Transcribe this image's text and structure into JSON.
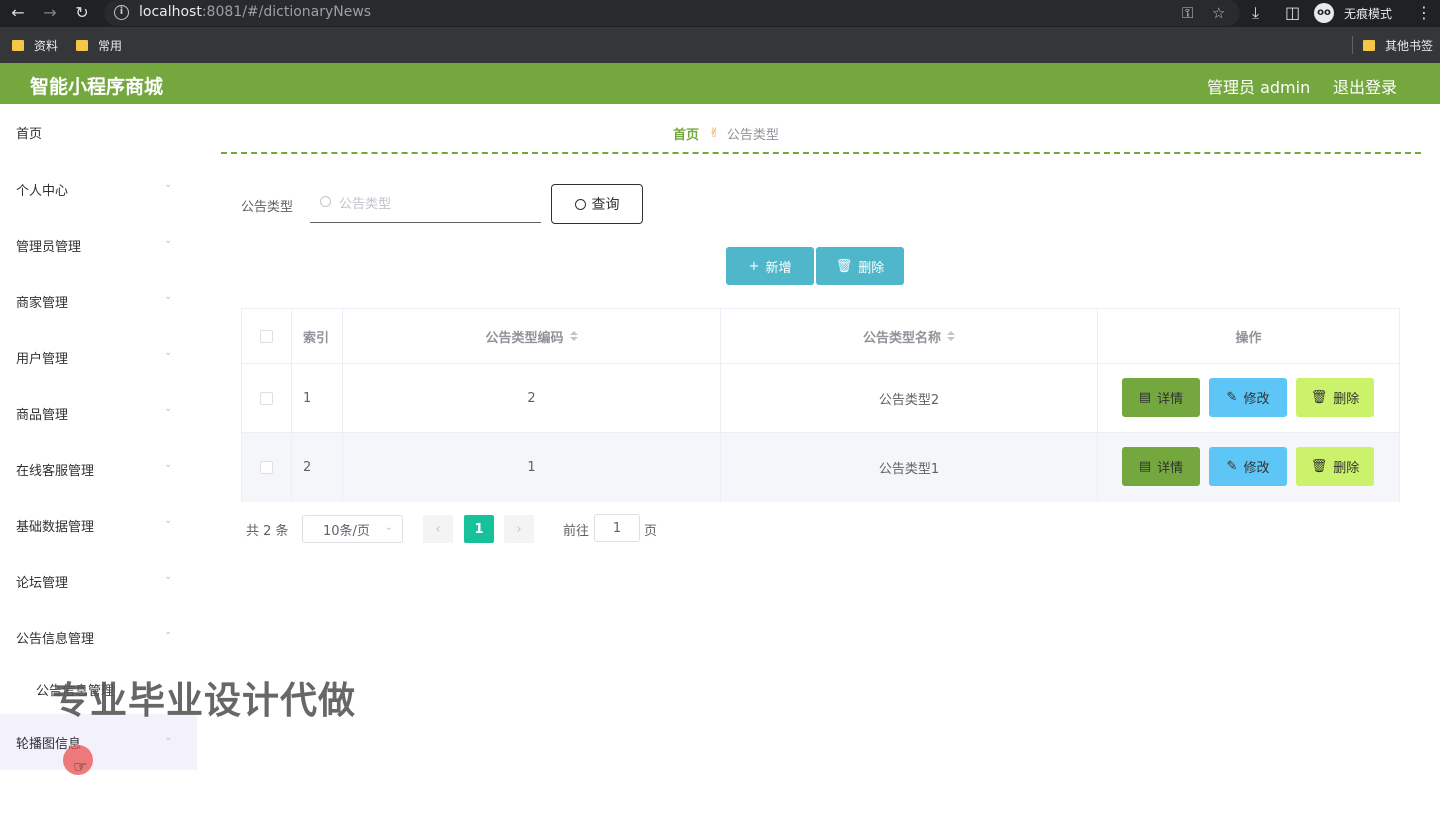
{
  "browser": {
    "url_host": "localhost",
    "url_rest": ":8081/#/dictionaryNews",
    "incognito_label": "无痕模式",
    "bookmarks": [
      "资料",
      "常用"
    ],
    "other_bookmarks": "其他书签"
  },
  "header": {
    "title": "智能小程序商城",
    "user": "管理员 admin",
    "logout": "退出登录",
    "accent": "#74a83f"
  },
  "sidebar": {
    "items": [
      {
        "label": "首页",
        "expandable": false
      },
      {
        "label": "个人中心",
        "expandable": true
      },
      {
        "label": "管理员管理",
        "expandable": true
      },
      {
        "label": "商家管理",
        "expandable": true
      },
      {
        "label": "用户管理",
        "expandable": true
      },
      {
        "label": "商品管理",
        "expandable": true
      },
      {
        "label": "在线客服管理",
        "expandable": true
      },
      {
        "label": "基础数据管理",
        "expandable": true
      },
      {
        "label": "论坛管理",
        "expandable": true
      },
      {
        "label": "公告信息管理",
        "expandable": true,
        "expanded": true
      },
      {
        "label": "公告信息管理",
        "submenu": true
      },
      {
        "label": "轮播图信息",
        "expandable": true,
        "hovered": true
      }
    ]
  },
  "breadcrumb": {
    "home": "首页",
    "current": "公告类型"
  },
  "search": {
    "label": "公告类型",
    "placeholder": "公告类型",
    "value": "",
    "button": "查询"
  },
  "actions": {
    "add": "新增",
    "delete": "删除"
  },
  "table": {
    "headers": {
      "index": "索引",
      "code": "公告类型编码",
      "name": "公告类型名称",
      "ops": "操作"
    },
    "rows": [
      {
        "index": "1",
        "code": "2",
        "name": "公告类型2"
      },
      {
        "index": "2",
        "code": "1",
        "name": "公告类型1"
      }
    ],
    "row_buttons": {
      "detail": "详情",
      "edit": "修改",
      "delete": "删除"
    }
  },
  "pagination": {
    "total": "共 2 条",
    "page_size": "10条/页",
    "current_page": "1",
    "goto_label": "前往",
    "goto_value": "1",
    "page_suffix": "页"
  },
  "overlay": {
    "watermark": "专业毕业设计代做"
  }
}
